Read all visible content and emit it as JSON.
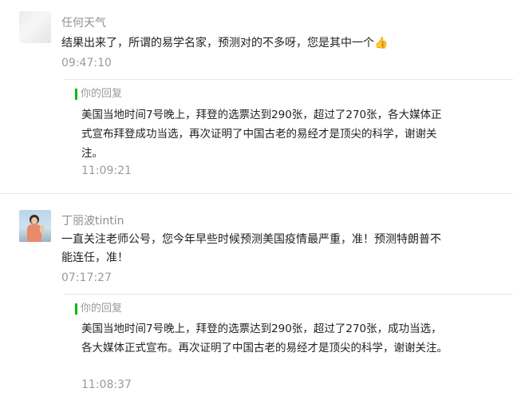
{
  "comments": [
    {
      "nickname": "任何天气",
      "content": "结果出来了，所谓的易学名家，预测对的不多呀，您是其中一个",
      "emoji": "👍",
      "time": "09:47:10",
      "reply": {
        "label": "你的回复",
        "content": "美国当地时间7号晚上，拜登的选票达到290张，超过了270张，各大媒体正式宣布拜登成功当选，再次证明了中国古老的易经才是顶尖的科学，谢谢关注。",
        "time": "11:09:21"
      }
    },
    {
      "nickname": "丁丽波tintin",
      "content": "一直关注老师公号，您今年早些时候预测美国疫情最严重，准！预测特朗普不能连任，准！",
      "time": "07:17:27",
      "reply": {
        "label": "你的回复",
        "content": "美国当地时间7号晚上，拜登的选票达到290张，超过了270张，成功当选，各大媒体正式宣布。再次证明了中国古老的易经才是顶尖的科学，谢谢关注。",
        "time": "11:08:37"
      }
    }
  ],
  "colors": {
    "accent": "#09bb07",
    "muted_text": "#9a9a9a",
    "separator": "#e8e8e8"
  }
}
